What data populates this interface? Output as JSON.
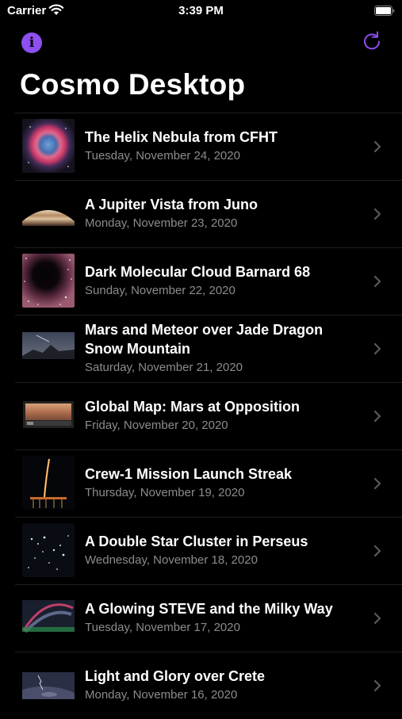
{
  "status_bar": {
    "carrier": "Carrier",
    "time": "3:39 PM"
  },
  "nav": {
    "title": "Cosmo Desktop",
    "info_icon": "info-icon",
    "refresh_icon": "refresh-icon",
    "accent": "#8e4ff0"
  },
  "items": [
    {
      "title": "The Helix Nebula from CFHT",
      "date": "Tuesday, November 24, 2020"
    },
    {
      "title": "A Jupiter Vista from Juno",
      "date": "Monday, November 23, 2020"
    },
    {
      "title": "Dark Molecular Cloud Barnard 68",
      "date": "Sunday, November 22, 2020"
    },
    {
      "title": "Mars and Meteor over Jade Dragon Snow Mountain",
      "date": "Saturday, November 21, 2020"
    },
    {
      "title": "Global Map: Mars at Opposition",
      "date": "Friday, November 20, 2020"
    },
    {
      "title": "Crew-1 Mission Launch Streak",
      "date": "Thursday, November 19, 2020"
    },
    {
      "title": "A Double Star Cluster in Perseus",
      "date": "Wednesday, November 18, 2020"
    },
    {
      "title": "A Glowing STEVE and the Milky Way",
      "date": "Tuesday, November 17, 2020"
    },
    {
      "title": "Light and Glory over Crete",
      "date": "Monday, November 16, 2020"
    }
  ]
}
